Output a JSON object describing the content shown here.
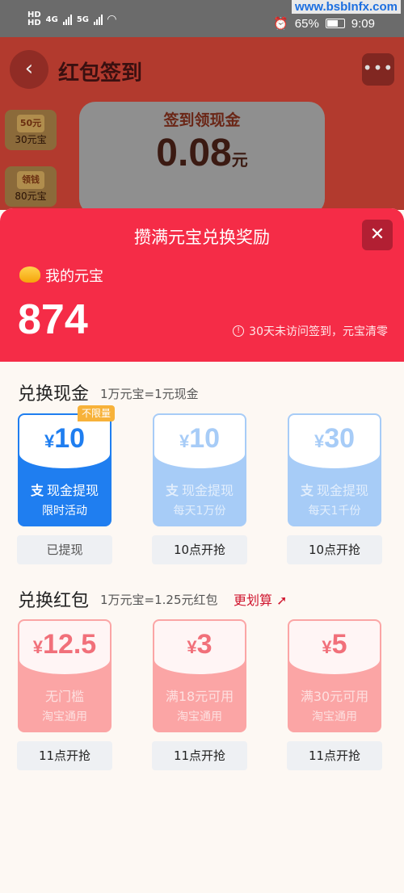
{
  "status_bar": {
    "network_top": "HD",
    "network_bottom": "HD",
    "gen1": "4G",
    "gen2": "5G",
    "alarm_icon": "alarm-icon",
    "battery": "65%",
    "time": "9:09"
  },
  "watermark": "www.bsbInfx.com",
  "background_page": {
    "title": "红包签到",
    "back_icon": "chevron-left-icon",
    "more_icon": "more-dots-icon",
    "card_label": "签到领现金",
    "card_amount": "0.08",
    "card_unit": "元",
    "tiles": [
      {
        "mini": "50元",
        "label": "30元宝"
      },
      {
        "mini": "领钱",
        "label": "80元宝"
      }
    ]
  },
  "sheet": {
    "title": "攒满元宝兑换奖励",
    "close_icon": "close-icon",
    "my_label": "我的元宝",
    "balance": "874",
    "notice": "30天未访问签到，元宝清零"
  },
  "cash_section": {
    "title": "兑换现金",
    "rate": "1万元宝=1元现金",
    "badge": "不限量",
    "cards": [
      {
        "currency": "¥",
        "amount": "10",
        "name": "现金提现",
        "detail": "限时活动",
        "button": "已提现",
        "state": "active"
      },
      {
        "currency": "¥",
        "amount": "10",
        "name": "现金提现",
        "detail": "每天1万份",
        "button": "10点开抢",
        "state": "dim"
      },
      {
        "currency": "¥",
        "amount": "30",
        "name": "现金提现",
        "detail": "每天1千份",
        "button": "10点开抢",
        "state": "dim"
      }
    ]
  },
  "redpacket_section": {
    "title": "兑换红包",
    "rate": "1万元宝=1.25元红包",
    "promo": "更划算",
    "cards": [
      {
        "currency": "¥",
        "amount": "12.5",
        "name": "无门槛",
        "detail": "淘宝通用",
        "button": "11点开抢"
      },
      {
        "currency": "¥",
        "amount": "3",
        "name": "满18元可用",
        "detail": "淘宝通用",
        "button": "11点开抢"
      },
      {
        "currency": "¥",
        "amount": "5",
        "name": "满30元可用",
        "detail": "淘宝通用",
        "button": "11点开抢"
      }
    ]
  },
  "colors": {
    "header_red": "#f52c47",
    "cash_blue": "#1f7ef0",
    "cash_blue_dim": "#a7ccf7",
    "red_dim": "#fba5a5",
    "badge_orange": "#f7b23a"
  }
}
